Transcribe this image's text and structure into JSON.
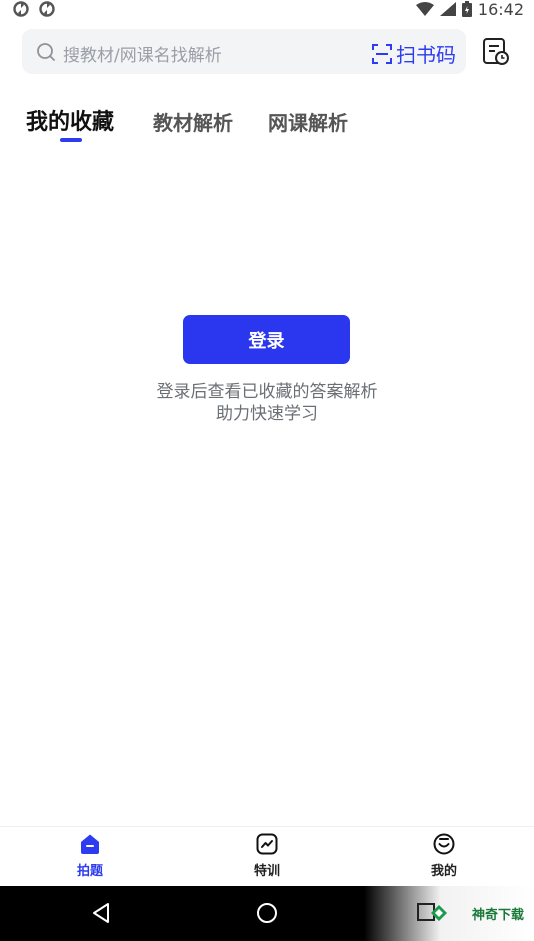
{
  "status": {
    "time": "16:42"
  },
  "search": {
    "placeholder": "搜教材/网课名找解析",
    "scan_label": "扫书码"
  },
  "tabs": [
    {
      "label": "我的收藏",
      "active": true
    },
    {
      "label": "教材解析",
      "active": false
    },
    {
      "label": "网课解析",
      "active": false
    }
  ],
  "login": {
    "button_label": "登录",
    "hint_line1": "登录后查看已收藏的答案解析",
    "hint_line2": "助力快速学习"
  },
  "bottom_nav": [
    {
      "label": "拍题",
      "icon": "home-icon",
      "active": true
    },
    {
      "label": "特训",
      "icon": "training-icon",
      "active": false
    },
    {
      "label": "我的",
      "icon": "profile-icon",
      "active": false
    }
  ],
  "watermark": {
    "text": "神奇下载"
  },
  "colors": {
    "accent": "#2b36ef",
    "nav_bg": "#000000",
    "search_bg": "#f3f4f6"
  }
}
